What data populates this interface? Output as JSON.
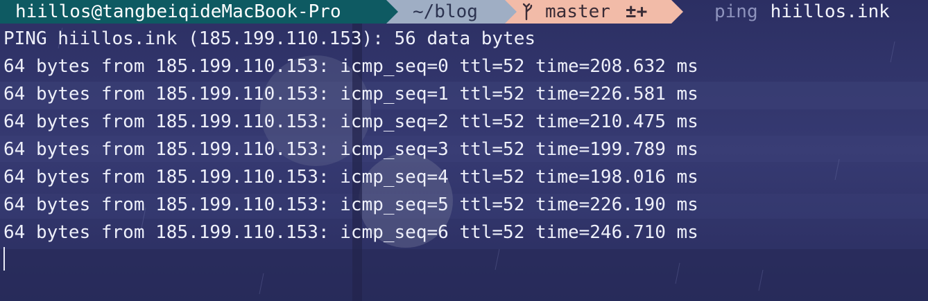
{
  "prompt": {
    "user_host": "hiillos@tangbeiqideMacBook-Pro",
    "directory": "~/blog",
    "git_branch": "master",
    "git_status": "±+",
    "command": "ping",
    "argument": "hiillos.ink"
  },
  "output": {
    "header": "PING hiillos.ink (185.199.110.153): 56 data bytes",
    "lines": [
      "64 bytes from 185.199.110.153: icmp_seq=0 ttl=52 time=208.632 ms",
      "64 bytes from 185.199.110.153: icmp_seq=1 ttl=52 time=226.581 ms",
      "64 bytes from 185.199.110.153: icmp_seq=2 ttl=52 time=210.475 ms",
      "64 bytes from 185.199.110.153: icmp_seq=3 ttl=52 time=199.789 ms",
      "64 bytes from 185.199.110.153: icmp_seq=4 ttl=52 time=198.016 ms",
      "64 bytes from 185.199.110.153: icmp_seq=5 ttl=52 time=226.190 ms",
      "64 bytes from 185.199.110.153: icmp_seq=6 ttl=52 time=246.710 ms"
    ]
  },
  "colors": {
    "background": "#2f3268",
    "user_segment": "#0e5a62",
    "dir_segment": "#9faec4",
    "git_segment": "#f2bba8",
    "text": "#eef0fa"
  }
}
